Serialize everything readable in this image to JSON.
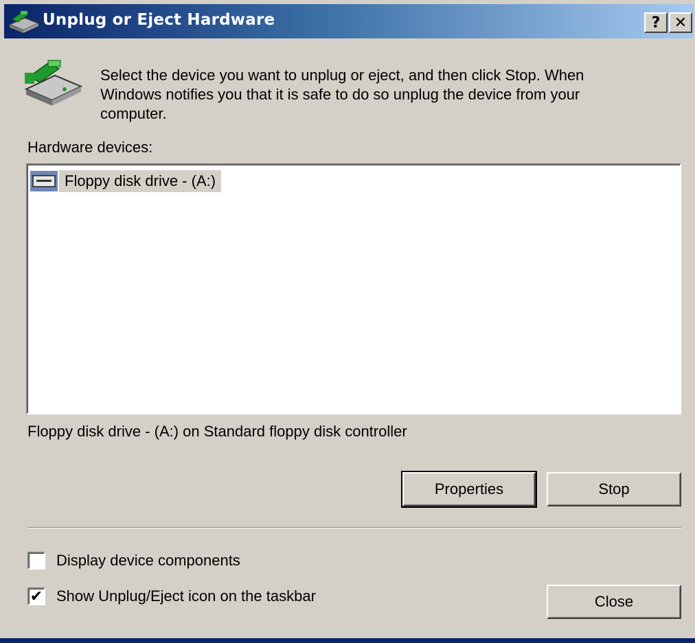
{
  "window": {
    "title": "Unplug or Eject Hardware",
    "help_button": "?",
    "close_button": "✕"
  },
  "instructions": "Select the device you want to unplug or eject, and then click Stop. When\nWindows notifies you that it is safe to do so unplug the device from your\ncomputer.",
  "devices_label": "Hardware devices:",
  "devices": [
    {
      "label": "Floppy disk drive - (A:)",
      "icon": "floppy-drive-icon",
      "selected": true
    }
  ],
  "device_description": "Floppy disk drive - (A:) on Standard floppy disk controller",
  "buttons": {
    "properties": "Properties",
    "stop": "Stop",
    "close": "Close"
  },
  "checkboxes": {
    "display_components": {
      "label": "Display device components",
      "checked": false,
      "mark": ""
    },
    "show_icon": {
      "label": "Show Unplug/Eject icon on the taskbar",
      "checked": true,
      "mark": "✔"
    }
  },
  "colors": {
    "title_gradient_start": "#0a246a",
    "title_gradient_end": "#a6caf0",
    "dialog_face": "#d4d0c8",
    "selection_icon_bg": "#6f87b7"
  }
}
